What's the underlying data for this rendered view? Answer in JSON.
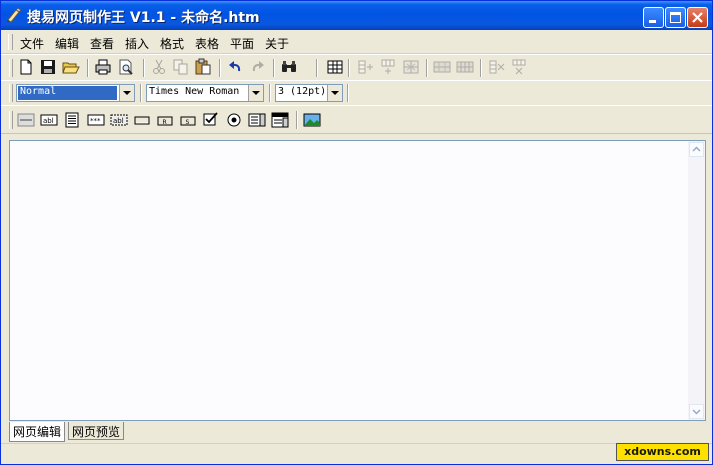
{
  "window": {
    "title": "搜易网页制作王 V1.1 - 未命名.htm",
    "buttons": {
      "minimize": "minimize-icon",
      "maximize": "maximize-icon",
      "close": "close-icon"
    }
  },
  "menu": {
    "items": [
      "文件",
      "编辑",
      "查看",
      "插入",
      "格式",
      "表格",
      "平面",
      "关于"
    ]
  },
  "toolbar1": {
    "icons": [
      "new-icon",
      "save-icon",
      "open-icon",
      "print-icon",
      "print-preview-icon",
      "cut-icon",
      "copy-icon",
      "paste-icon",
      "undo-icon",
      "redo-icon",
      "find-icon",
      "insert-table-icon",
      "insert-column-icon",
      "insert-row-icon",
      "insert-cell-icon",
      "merge-cells-icon",
      "split-cells-icon",
      "delete-column-icon",
      "delete-row-icon"
    ]
  },
  "format_bar": {
    "paragraph_style": "Normal",
    "font_family": "Times New Roman",
    "font_size": "3 (12pt)"
  },
  "form_bar": {
    "icons": [
      "horizontal-line-icon",
      "text-field-icon",
      "textarea-icon",
      "password-field-icon",
      "hidden-field-icon",
      "button-icon",
      "reset-button-icon",
      "submit-button-icon",
      "checkbox-icon",
      "radio-button-icon",
      "listbox-icon",
      "dropdown-icon",
      "image-icon"
    ]
  },
  "tabs": [
    "网页编辑",
    "网页预览"
  ],
  "watermark": "xdowns.com",
  "colors": {
    "titlebar": "#0054e3",
    "face": "#ece9d8",
    "selection": "#316ac5",
    "watermark_bg": "#ffe100"
  }
}
